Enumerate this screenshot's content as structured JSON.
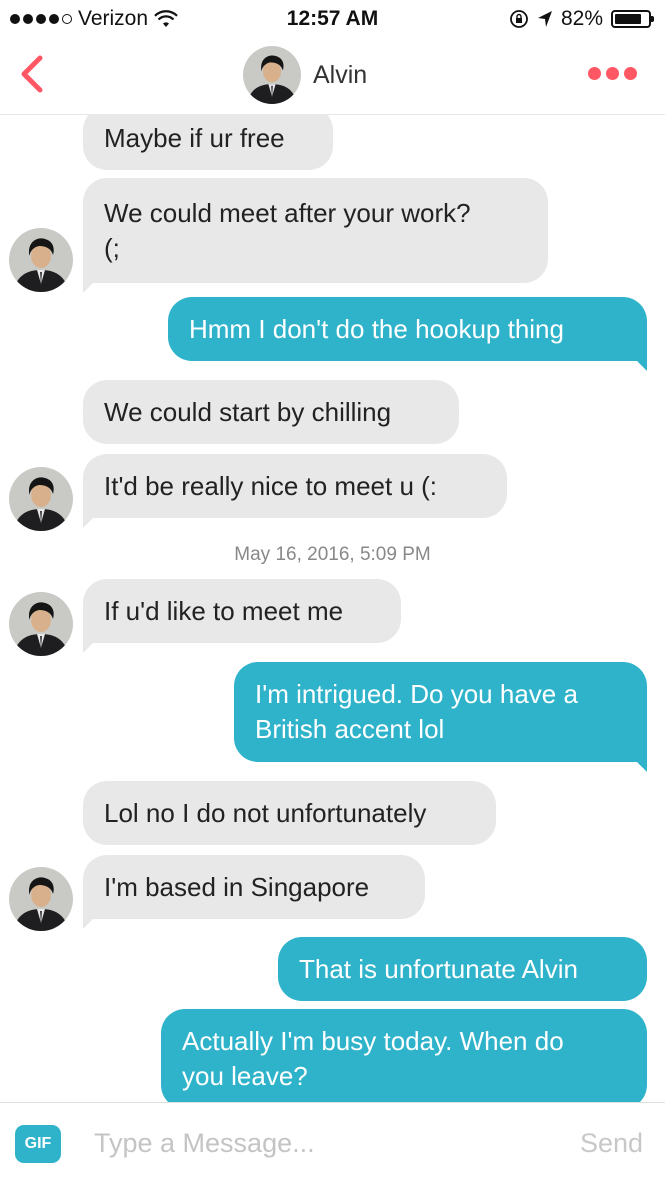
{
  "status_bar": {
    "carrier": "Verizon",
    "time": "12:57 AM",
    "battery": "82%",
    "battery_level": 0.82,
    "signal_icon": "signal-dots-icon",
    "wifi_icon": "wifi-icon",
    "orientation_lock_icon": "orientation-lock-icon",
    "location_icon": "location-arrow-icon",
    "battery_icon": "battery-icon"
  },
  "header": {
    "back_icon": "chevron-left-icon",
    "contact_name": "Alvin",
    "more_icon": "more-dots-icon",
    "accent_color": "#ff5864"
  },
  "messages": [
    {
      "from": "them",
      "text": "Maybe if ur free"
    },
    {
      "from": "them",
      "text": "We could meet after your work?\n(;"
    },
    {
      "from": "me",
      "text": "Hmm I don't do the hookup thing"
    },
    {
      "from": "them",
      "text": "We could start by chilling"
    },
    {
      "from": "them",
      "text": "It'd be really nice to meet u (:"
    },
    {
      "from": "them",
      "text": "If u'd like to meet me"
    },
    {
      "from": "me",
      "text": "I'm intrigued. Do you have a\nBritish accent lol"
    },
    {
      "from": "them",
      "text": "Lol no I do not unfortunately"
    },
    {
      "from": "them",
      "text": "I'm based in Singapore"
    },
    {
      "from": "me",
      "text": "That is unfortunate Alvin"
    },
    {
      "from": "me",
      "text": "Actually I'm busy today. When do\nyou leave?"
    }
  ],
  "timestamp": "May 16, 2016, 5:09 PM",
  "composer": {
    "gif_label": "GIF",
    "placeholder": "Type a Message...",
    "send_label": "Send"
  },
  "colors": {
    "outgoing_bubble": "#2fb3cb",
    "incoming_bubble": "#e8e8e8"
  }
}
